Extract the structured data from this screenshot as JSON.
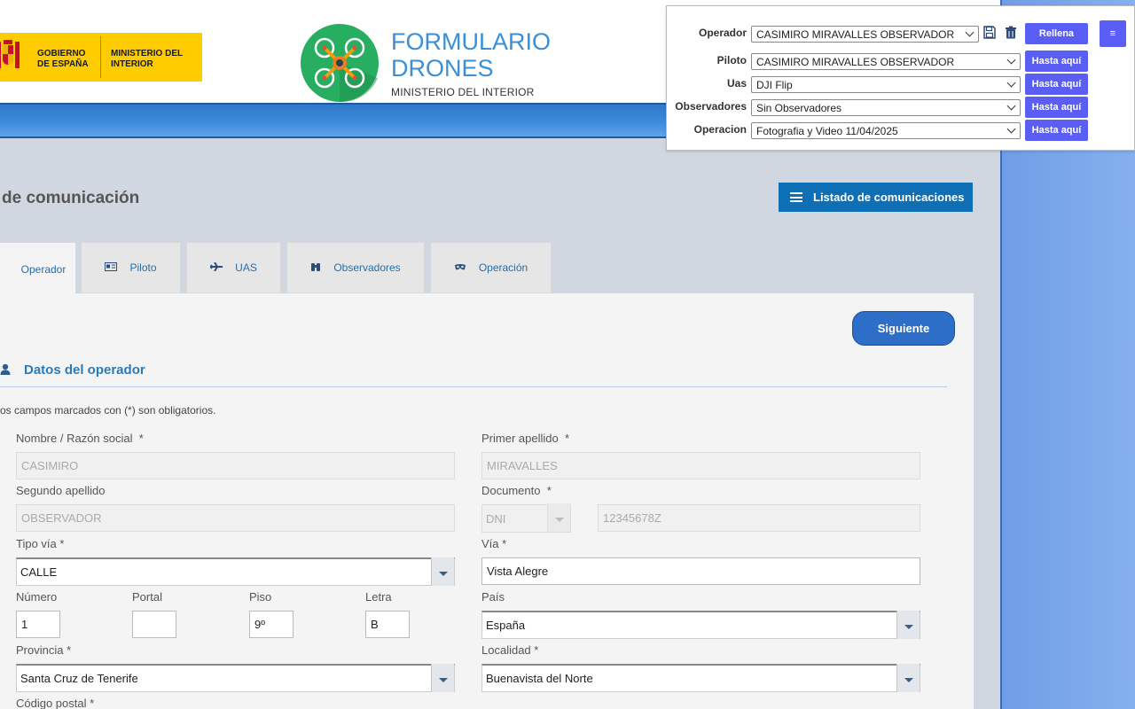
{
  "header": {
    "gov_line1": "GOBIERNO DE ESPAÑA",
    "gov_line2": "MINISTERIO DEL INTERIOR",
    "brand_title": "FORMULARIO DRONES",
    "brand_subtitle": "MINISTERIO DEL INTERIOR"
  },
  "page": {
    "title": "de comunicación",
    "list_button": "Listado de comunicaciones"
  },
  "tabs": [
    {
      "label": "Operador",
      "icon": "user-icon",
      "active": true
    },
    {
      "label": "Piloto",
      "icon": "id-card-icon"
    },
    {
      "label": "UAS",
      "icon": "plane-icon"
    },
    {
      "label": "Observadores",
      "icon": "binoculars-icon"
    },
    {
      "label": "Operación",
      "icon": "mask-icon"
    }
  ],
  "form": {
    "next_button": "Siguiente",
    "section_title": "Datos del operador",
    "required_note": "os campos marcados con (*) son obligatorios.",
    "nombre": {
      "label": "Nombre / Razón social",
      "req": "*",
      "value": "CASIMIRO"
    },
    "primer_apellido": {
      "label": "Primer apellido",
      "req": "*",
      "value": "MIRAVALLES"
    },
    "segundo_apellido": {
      "label": "Segundo apellido",
      "value": "OBSERVADOR"
    },
    "documento": {
      "label": "Documento",
      "req": "*",
      "type": "DNI",
      "value": "12345678Z"
    },
    "tipo_via": {
      "label": "Tipo vía *",
      "value": "CALLE"
    },
    "via": {
      "label": "Vía *",
      "value": "Vista Alegre"
    },
    "numero": {
      "label": "Número",
      "value": "1"
    },
    "portal": {
      "label": "Portal",
      "value": ""
    },
    "piso": {
      "label": "Piso",
      "value": "9º"
    },
    "letra": {
      "label": "Letra",
      "value": "B"
    },
    "pais": {
      "label": "País",
      "value": "España"
    },
    "provincia": {
      "label": "Provincia *",
      "value": "Santa Cruz de Tenerife"
    },
    "localidad": {
      "label": "Localidad *",
      "value": "Buenavista del Norte"
    },
    "codigo_postal": {
      "label": "Código postal *"
    }
  },
  "tools": {
    "rows": [
      {
        "label": "Operador",
        "value": "CASIMIRO MIRAVALLES OBSERVADOR",
        "button": "Rellena"
      },
      {
        "label": "Piloto",
        "value": "CASIMIRO MIRAVALLES OBSERVADOR",
        "button": "Hasta aquí"
      },
      {
        "label": "Uas",
        "value": "DJI Flip",
        "button": "Hasta aquí"
      },
      {
        "label": "Observadores",
        "value": "Sin Observadores",
        "button": "Hasta aquí"
      },
      {
        "label": "Operacion",
        "value": "Fotografia y Video 11/04/2025",
        "button": "Hasta aquí"
      }
    ],
    "menu_button": "≡"
  },
  "colors": {
    "brand_blue": "#3a8fd6",
    "gov_yellow": "#ffcc00",
    "primary_button": "#2d6ec9",
    "tool_button": "#5b5ef5",
    "drone_green": "#27ae60"
  }
}
